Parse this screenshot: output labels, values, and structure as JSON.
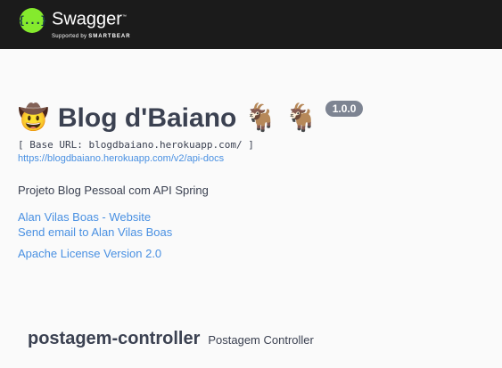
{
  "topbar": {
    "logo_mark": "{...}",
    "logo_word": "Swagger",
    "logo_tm": "™",
    "logo_sub_prefix": "Supported by",
    "logo_sub_brand": "SMARTBEAR",
    "colors": {
      "background": "#1b1b1b",
      "logo_badge": "#85ea2d"
    }
  },
  "info": {
    "title_emoji": "🤠",
    "title": "Blog d'Baiano",
    "title_suffix_emoji": "🐐 🐐",
    "version": "1.0.0",
    "base_url": "[ Base URL: blogdbaiano.herokuapp.com/ ]",
    "docs_link": "https://blogdbaiano.herokuapp.com/v2/api-docs",
    "description": "Projeto Blog Pessoal com API Spring",
    "contact_website": "Alan Vilas Boas - Website",
    "contact_email": "Send email to Alan Vilas Boas",
    "license": "Apache License Version 2.0"
  },
  "tag": {
    "name": "postagem-controller",
    "description": "Postagem Controller"
  }
}
